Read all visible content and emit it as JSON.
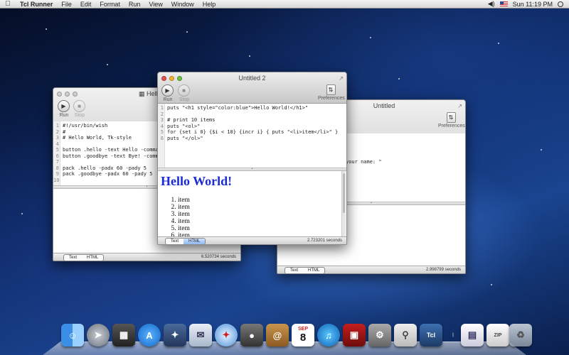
{
  "menubar": {
    "apple_icon": "apple-icon",
    "items": [
      "Tcl Runner",
      "File",
      "Edit",
      "Format",
      "Run",
      "View",
      "Window",
      "Help"
    ],
    "clock": "Sun 11:19 PM"
  },
  "toolbar": {
    "run_label": "Run",
    "stop_label": "Stop",
    "preferences_label": "Preferences"
  },
  "windows": {
    "hellowish": {
      "title": "HelloWis",
      "line_numbers": [
        "1",
        "2",
        "3",
        "4",
        "5",
        "6",
        "7",
        "8",
        "9",
        "10"
      ],
      "code": "#!/usr/bin/wish\n#\n# Hello World, Tk-style\n\nbutton .hello -text Hello -command {\nbutton .goodbye -text Bye! -command\n\npack .hello -padx 60 -pady 5\npack .goodbye -padx 60 -pady 5",
      "tab_text": "Text",
      "tab_html": "HTML",
      "timing": "6.520734 seconds"
    },
    "untitled2": {
      "title": "Untitled 2",
      "line_numbers": [
        "1",
        "2",
        "3",
        "4",
        "5",
        "6"
      ],
      "code": "puts \"<h1 style=\"color:blue\">Hello World!</h1>\"\n\n# print 10 items\nputs \"<ol>\"\nfor {set i 0} {$i < 10} {incr i} { puts \"<li>item</li>\" }\nputs \"</ol>\"",
      "heading": "Hello World!",
      "list_items": [
        "item",
        "item",
        "item",
        "item",
        "item",
        "item"
      ],
      "tab_text": "Text",
      "tab_html": "HTML",
      "timing": "2.723201 seconds"
    },
    "untitled": {
      "title": "Untitled",
      "code_fragment": "your name: \"",
      "tab_text": "Text",
      "tab_html": "HTML",
      "timing": "2.998799 seconds"
    }
  },
  "dock": {
    "icons": [
      "finder-icon",
      "launchpad-icon",
      "mission-control-icon",
      "app-store-icon",
      "preview-icon",
      "mail-icon",
      "safari-icon",
      "facetime-icon",
      "address-book-icon",
      "calendar-icon",
      "itunes-icon",
      "photo-booth-icon",
      "system-preferences-icon",
      "preview-icon",
      "tcl-runner-icon",
      "documents-stack-icon",
      "zip-file-icon",
      "trash-icon"
    ],
    "calendar_month": "SEP",
    "calendar_day": "8",
    "tcl_label": "Tcl",
    "zip_label": "ZIP"
  }
}
